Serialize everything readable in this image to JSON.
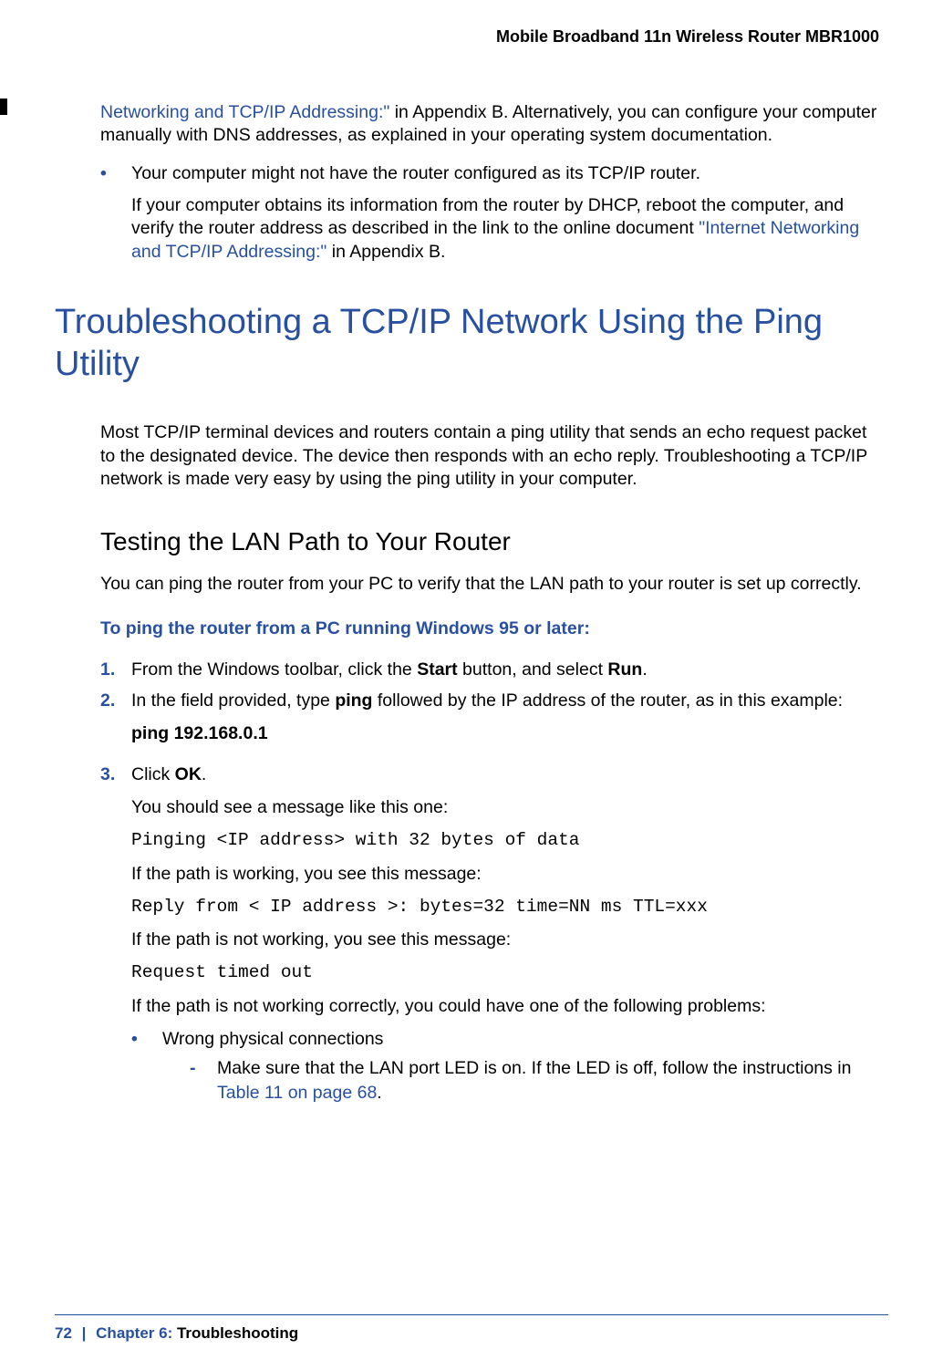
{
  "header": {
    "title": "Mobile Broadband 11n Wireless Router MBR1000"
  },
  "top": {
    "link1": "Networking and TCP/IP Addressing:\"",
    "rest1": " in Appendix B. Alternatively, you can configure your computer manually with DNS addresses, as explained in your operating system documentation.",
    "bullet2_lead": "Your computer might not have the router configured as its TCP/IP router.",
    "bullet2_para_pre": "If your computer obtains its information from the router by DHCP, reboot the computer, and verify the router address as described in the link to the online document ",
    "bullet2_link": "\"Internet Networking and TCP/IP Addressing:\"",
    "bullet2_para_post": " in Appendix B."
  },
  "h1": "Troubleshooting a TCP/IP Network Using the Ping Utility",
  "intro": "Most TCP/IP terminal devices and routers contain a ping utility that sends an echo request packet to the designated device. The device then responds with an echo reply. Troubleshooting a TCP/IP network is made very easy by using the ping utility in your computer.",
  "h2": "Testing the LAN Path to Your Router",
  "p1": "You can ping the router from your PC to verify that the LAN path to your router is set up correctly.",
  "task": "To ping the router from a PC running Windows 95 or later:",
  "steps": {
    "s1": {
      "num": "1.",
      "pre": "From the Windows toolbar, click the ",
      "b1": "Start",
      "mid": " button, and select ",
      "b2": "Run",
      "post": "."
    },
    "s2": {
      "num": "2.",
      "pre": "In the field provided, type ",
      "b1": "ping",
      "post": " followed by the IP address of the router, as in this example:",
      "example": "ping 192.168.0.1"
    },
    "s3": {
      "num": "3.",
      "pre": "Click ",
      "b1": "OK",
      "post": ".",
      "p1": "You should see a message like this one:",
      "code1": "Pinging <IP address> with 32 bytes of data",
      "p2": "If the path is working, you see this message:",
      "code2": "Reply from < IP address >: bytes=32 time=NN ms TTL=xxx",
      "p3": "If the path is not working, you see this message:",
      "code3": "Request timed out",
      "p4": "If the path is not working correctly, you could have one of the following problems:",
      "sub1": "Wrong physical connections",
      "subsub_pre": "Make sure that the LAN port LED is on. If the LED is off, follow the instructions in ",
      "subsub_link": "Table 11 on page 68",
      "subsub_post": "."
    }
  },
  "footer": {
    "page": "72",
    "sep": "|",
    "chapter": "Chapter 6:",
    "title": "Troubleshooting"
  },
  "marks": {
    "bullet": "•",
    "dash": "-"
  }
}
